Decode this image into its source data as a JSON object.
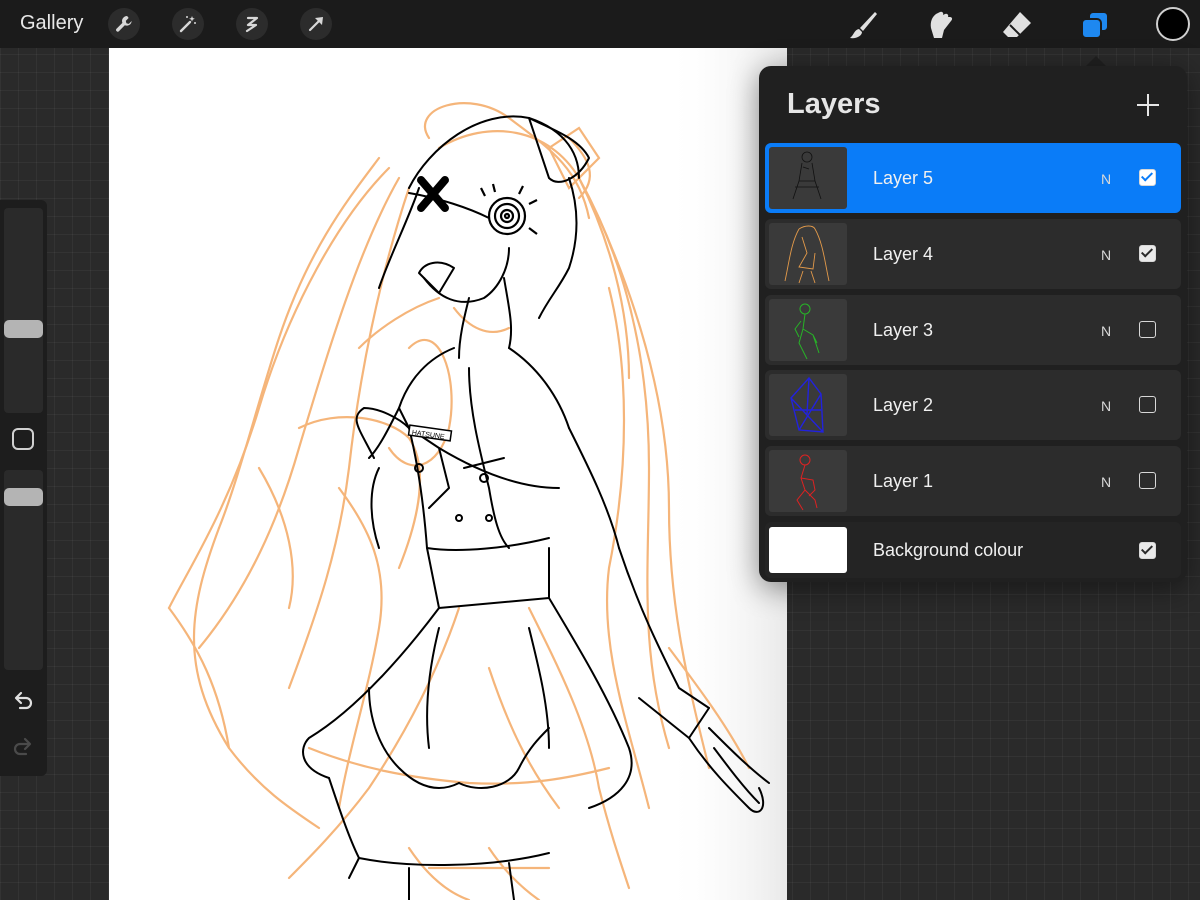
{
  "topbar": {
    "gallery_label": "Gallery",
    "left_tools": [
      "wrench-icon",
      "magic-wand-icon",
      "selection-icon",
      "transform-arrow-icon"
    ],
    "right_tools": [
      "brush-icon",
      "smudge-icon",
      "eraser-icon",
      "layers-icon"
    ],
    "active_color": "#000000",
    "layers_tool_color": "#1e88f0"
  },
  "sidebar": {
    "brush_size_level": 0.4,
    "opacity_level": 0.9,
    "undo_icon": "undo-icon",
    "redo_icon": "redo-icon"
  },
  "layers_panel": {
    "title": "Layers",
    "add_icon": "plus-icon",
    "layers": [
      {
        "name": "Layer 5",
        "blend": "N",
        "visible": true,
        "selected": true,
        "thumb_color": "#111111"
      },
      {
        "name": "Layer 4",
        "blend": "N",
        "visible": true,
        "selected": false,
        "thumb_color": "#e39a4a"
      },
      {
        "name": "Layer 3",
        "blend": "N",
        "visible": false,
        "selected": false,
        "thumb_color": "#27b327"
      },
      {
        "name": "Layer 2",
        "blend": "N",
        "visible": false,
        "selected": false,
        "thumb_color": "#2222dd"
      },
      {
        "name": "Layer 1",
        "blend": "N",
        "visible": false,
        "selected": false,
        "thumb_color": "#dd2222"
      }
    ],
    "background": {
      "name": "Background colour",
      "visible": true,
      "color": "#ffffff"
    }
  },
  "canvas": {
    "sketch_color": "#f5b57a",
    "ink_color": "#000000",
    "name_tag": "HATSUNE"
  }
}
